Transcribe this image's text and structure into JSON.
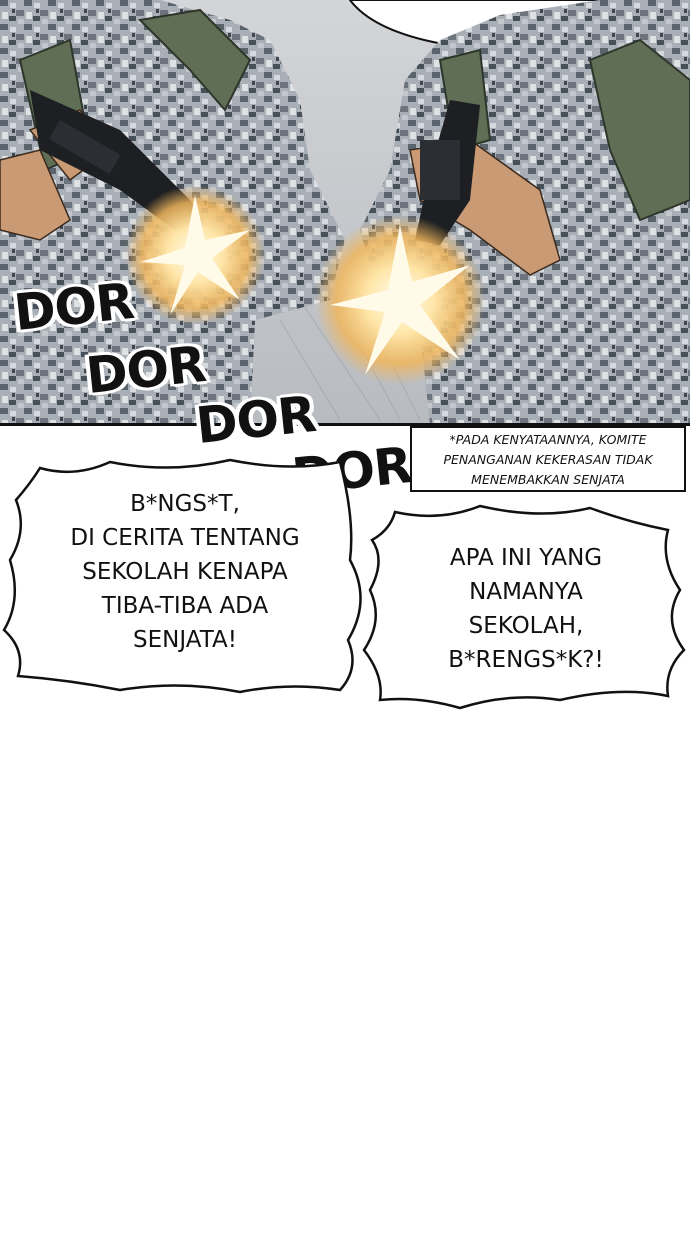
{
  "sound_effects": [
    "DOR",
    "DOR",
    "DOR",
    "DOR"
  ],
  "note": {
    "lines": [
      "*PADA KENYATAANNYA, KOMITE",
      "PENANGANAN KEKERASAN TIDAK",
      "MENEMBAKKAN SENJATA"
    ]
  },
  "bubble_left": {
    "lines": [
      "B*NGS*T,",
      "DI CERITA TENTANG",
      "SEKOLAH KENAPA",
      "TIBA-TIBA ADA",
      "SENJATA!"
    ]
  },
  "bubble_right": {
    "lines": [
      "APA INI YANG",
      "NAMANYA",
      "SEKOLAH,",
      "B*RENGS*K?!"
    ]
  },
  "colors": {
    "camo_light": "#b9bec4",
    "camo_dark": "#4a525b",
    "strap_green": "#5f6e55",
    "skin": "#c99a74",
    "flash": "#ffd98a",
    "ink": "#111111"
  }
}
